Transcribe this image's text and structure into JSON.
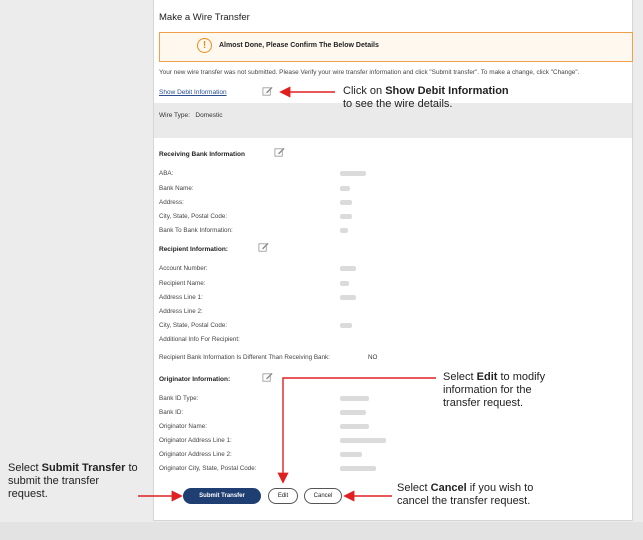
{
  "page": {
    "title": "Make a Wire Transfer"
  },
  "alert": {
    "text": "Almost Done, Please Confirm The Below Details",
    "icon": "exclamation-circle-icon"
  },
  "notice": "Your new wire transfer was not submitted. Please Verify your wire transfer information and click \"Submit transfer\". To make a change, click \"Change\".",
  "show_debit_link": "Show Debit Information",
  "wire_type": {
    "label": "Wire Type:",
    "value": "Domestic"
  },
  "receiving_bank": {
    "heading": "Receiving Bank Information",
    "rows": [
      {
        "label": "ABA:"
      },
      {
        "label": "Bank Name:"
      },
      {
        "label": "Address:"
      },
      {
        "label": "City, State, Postal Code:"
      },
      {
        "label": "Bank To Bank Information:"
      }
    ]
  },
  "recipient": {
    "heading": "Recipient Information:",
    "rows": [
      {
        "label": "Account Number:"
      },
      {
        "label": "Recipient Name:"
      },
      {
        "label": "Address Line 1:"
      },
      {
        "label": "Address Line 2:"
      },
      {
        "label": "City, State, Postal Code:"
      },
      {
        "label": "Additional Info For Recipient:"
      }
    ],
    "different_bank": {
      "label": "Recipient Bank Information Is Different Than Receiving Bank:",
      "value": "NO"
    }
  },
  "originator": {
    "heading": "Originator Information:",
    "rows": [
      {
        "label": "Bank ID Type:"
      },
      {
        "label": "Bank ID:"
      },
      {
        "label": "Originator Name:"
      },
      {
        "label": "Originator Address Line 1:"
      },
      {
        "label": "Originator Address Line 2:"
      },
      {
        "label": "Originator City, State, Postal Code:"
      }
    ]
  },
  "buttons": {
    "submit": "Submit Transfer",
    "edit": "Edit",
    "cancel": "Cancel"
  },
  "callouts": {
    "show_debit": {
      "pre": "Click on ",
      "bold": "Show Debit Information",
      "post": "to see the wire details."
    },
    "edit": {
      "pre": "Select ",
      "bold": "Edit",
      "post": " to modify information for the transfer request."
    },
    "submit": {
      "pre": "Select ",
      "bold": "Submit Transfer",
      "post": " to submit the transfer request."
    },
    "cancel": {
      "pre": "Select ",
      "bold": "Cancel",
      "post": " if you wish to cancel the transfer request."
    }
  },
  "colors": {
    "accent": "#1f3f73",
    "link": "#2a4d8f",
    "warning": "#f0891a",
    "arrow": "#e02020"
  }
}
